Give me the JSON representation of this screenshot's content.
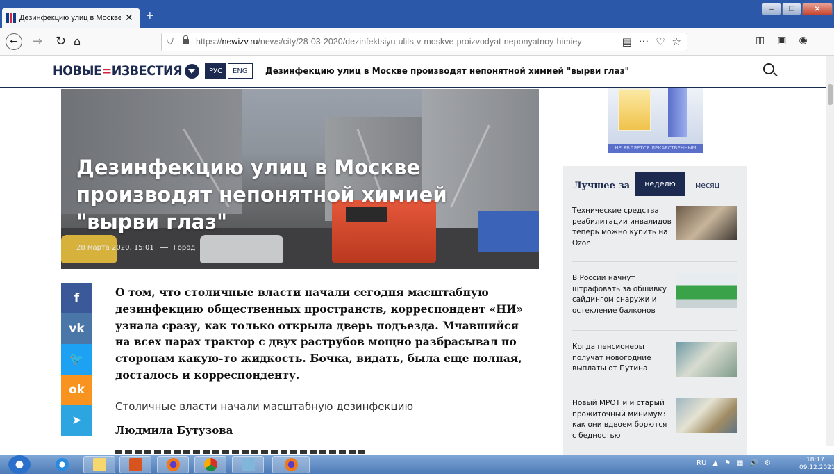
{
  "browser": {
    "tab_title": "Дезинфекцию улиц в Москве",
    "tab_close": "✕",
    "new_tab": "+",
    "url_prefix": "https://",
    "url_host": "newizv.ru",
    "url_path": "/news/city/28-03-2020/dezinfektsiyu-ulits-v-moskve-proizvodyat-neponyatnoy-himiey",
    "win_minimize": "–",
    "win_maximize": "❐",
    "win_close": "✕"
  },
  "site": {
    "logo_left": "НОВЫЕ",
    "logo_dash": "=",
    "logo_right": "ИЗВЕСТИЯ",
    "lang_ru": "РУС",
    "lang_en": "ENG",
    "header_headline": "Дезинфекцию улиц в Москве производят непонятной химией \"вырви глаз\""
  },
  "article": {
    "title": "Дезинфекцию улиц в Москве производят непонятной химией \"вырви глаз\"",
    "date": "28 марта 2020, 15:01",
    "rubric": "Город",
    "lead": "О том, что столичные власти начали сегодня масштабную дезинфекцию общественных пространств, корреспондент «НИ» узнала сразу, как только открыла дверь подъезда. Мчавшийся на всех парах трактор с двух раструбов мощно разбрасывал по сторонам какую-то жидкость. Бочка, видать, была еще полная, досталось и корреспонденту.",
    "caption": "Столичные власти начали масштабную дезинфекцию",
    "author": "Людмила Бутузова"
  },
  "social": {
    "facebook": "f",
    "vk": "vk",
    "twitter": "🐦",
    "ok": "ok",
    "telegram": "➤"
  },
  "ad": {
    "strip_text": "НЕ ЯВЛЯЕТСЯ ЛЕКАРСТВЕННЫМ СРЕДСТВОМ"
  },
  "sidebar": {
    "best_label": "Лучшее за",
    "tab_week": "неделю",
    "tab_month": "месяц",
    "items": [
      {
        "text": "Технические средства реабилитации инвалидов теперь можно купить на Ozon"
      },
      {
        "text": "В России начнут штрафовать за обшивку сайдингом снаружи и остекление балконов"
      },
      {
        "text": "Когда пенсионеры получат новогодние выплаты от Путина"
      },
      {
        "text": "Новый МРОТ и и старый прожиточный минимум: как они вдвоем борются с бедностью"
      }
    ]
  },
  "taskbar": {
    "lang": "RU",
    "time": "18:17",
    "date": "09.12.2021"
  }
}
